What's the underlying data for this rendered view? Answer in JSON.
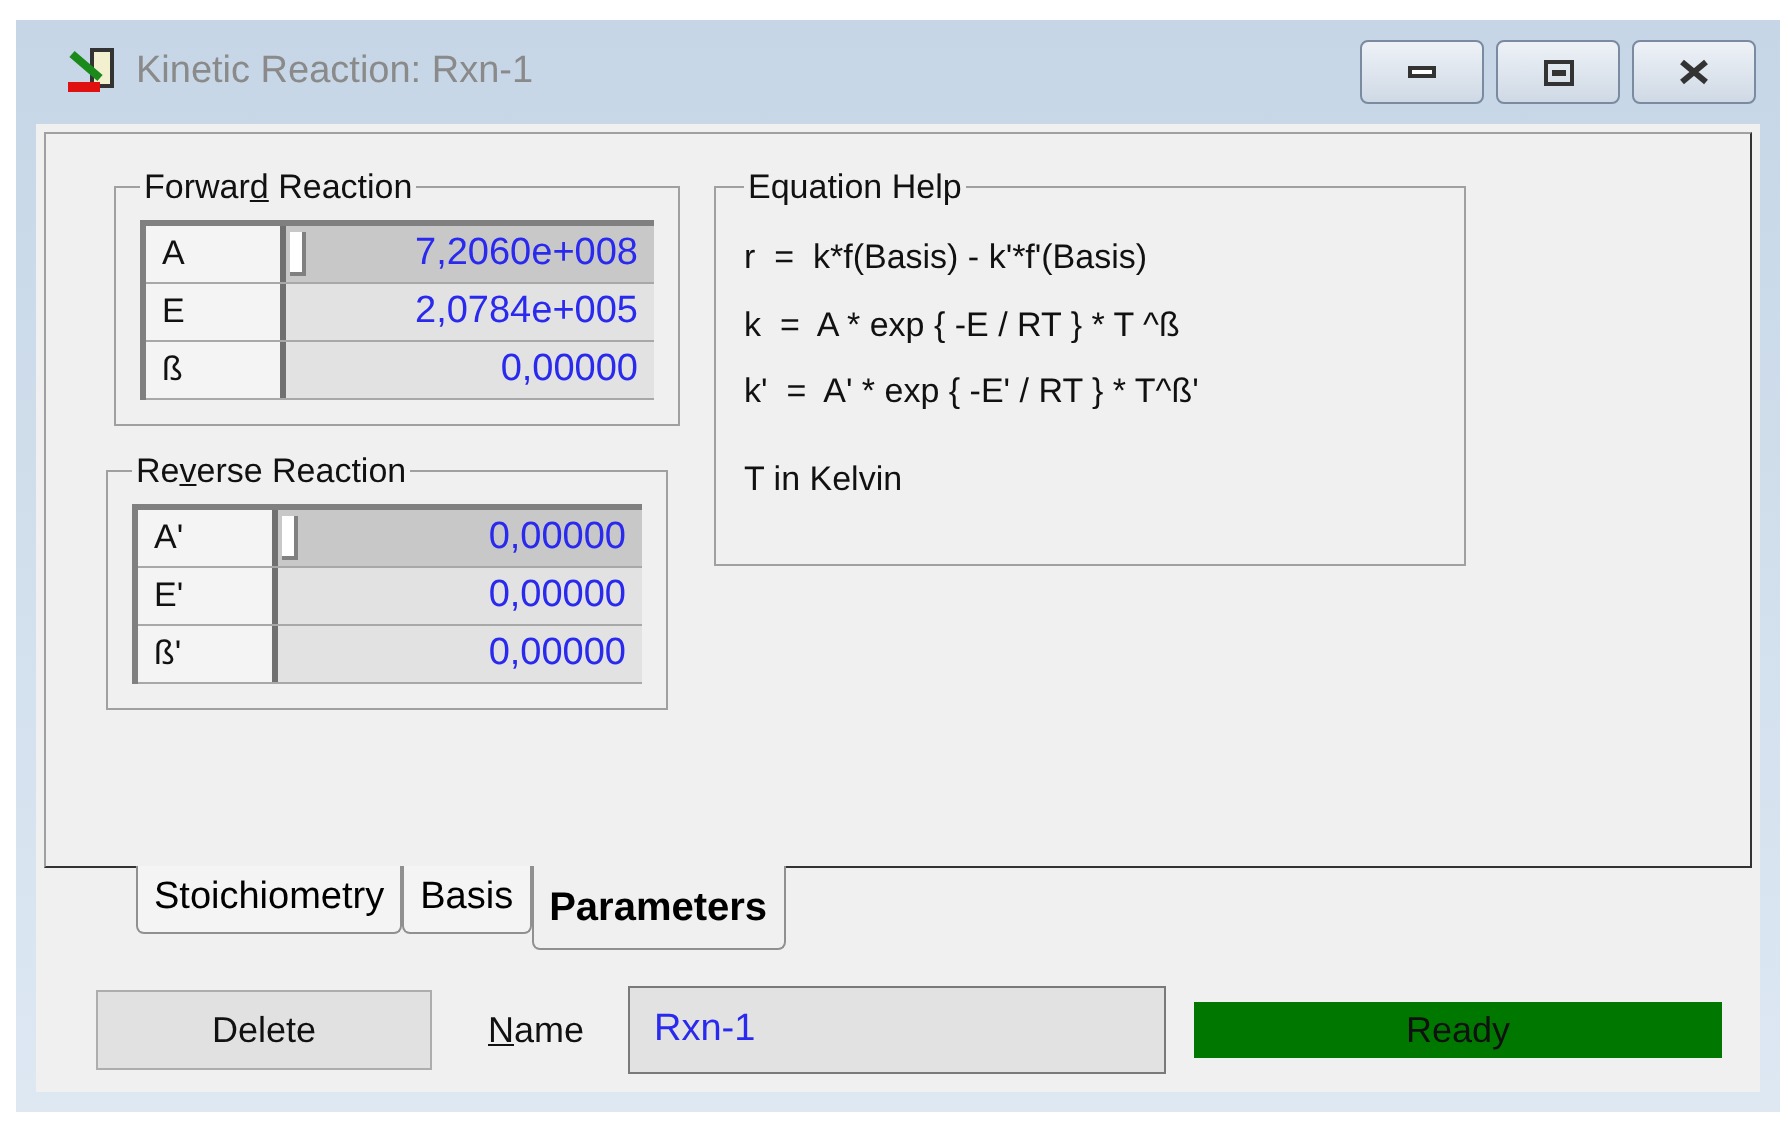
{
  "window": {
    "title": "Kinetic Reaction: Rxn-1"
  },
  "forward_reaction": {
    "title": {
      "before": "Forwar",
      "key": "d",
      "after": " Reaction"
    },
    "rows": [
      {
        "label": "A",
        "value": "7,2060e+008",
        "selected": true
      },
      {
        "label": "E",
        "value": "2,0784e+005",
        "selected": false
      },
      {
        "label": "ß",
        "value": "0,00000",
        "selected": false
      }
    ]
  },
  "reverse_reaction": {
    "title": {
      "before": "Re",
      "key": "v",
      "after": "erse Reaction"
    },
    "rows": [
      {
        "label": "A'",
        "value": "0,00000",
        "selected": true
      },
      {
        "label": "E'",
        "value": "0,00000",
        "selected": false
      },
      {
        "label": "ß'",
        "value": "0,00000",
        "selected": false
      }
    ]
  },
  "equation_help": {
    "title": {
      "before": "Equation Help"
    },
    "lines": [
      "r  =  k*f(Basis) - k'*f'(Basis)",
      "k  =  A * exp { -E / RT } * T ^ß",
      "k'  =  A' * exp { -E' / RT } * T^ß'",
      "T in Kelvin"
    ]
  },
  "tabs": [
    {
      "label": "Stoichiometry",
      "selected": false
    },
    {
      "label": "Basis",
      "selected": false
    },
    {
      "label": "Parameters",
      "selected": true
    }
  ],
  "delete_button": "Delete",
  "name": {
    "label": {
      "key": "N",
      "after": "ame"
    },
    "value": "Rxn-1"
  },
  "status": {
    "text": "Ready",
    "color": "#007800"
  }
}
